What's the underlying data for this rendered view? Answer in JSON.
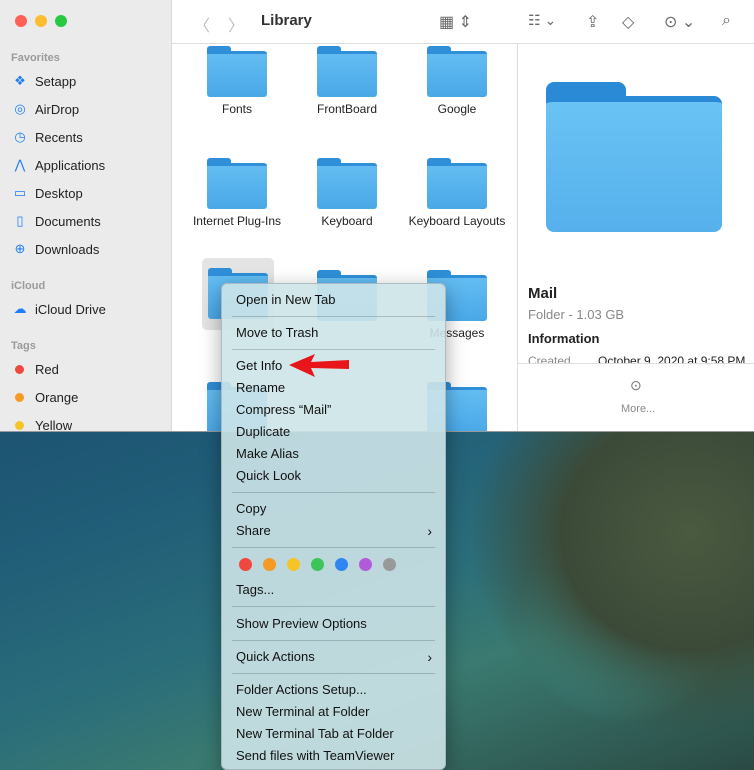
{
  "window": {
    "title": "Library"
  },
  "sidebar": {
    "favorites_label": "Favorites",
    "favorites": [
      {
        "label": "Setapp",
        "icon": "setapp-icon"
      },
      {
        "label": "AirDrop",
        "icon": "airdrop-icon"
      },
      {
        "label": "Recents",
        "icon": "clock-icon"
      },
      {
        "label": "Applications",
        "icon": "applications-icon"
      },
      {
        "label": "Desktop",
        "icon": "desktop-icon"
      },
      {
        "label": "Documents",
        "icon": "document-icon"
      },
      {
        "label": "Downloads",
        "icon": "download-icon"
      }
    ],
    "icloud_label": "iCloud",
    "icloud": [
      {
        "label": "iCloud Drive",
        "icon": "cloud-icon"
      }
    ],
    "tags_label": "Tags",
    "tags": [
      {
        "label": "Red",
        "color": "#f0473f"
      },
      {
        "label": "Orange",
        "color": "#f59a23"
      },
      {
        "label": "Yellow",
        "color": "#f5c426"
      }
    ]
  },
  "folders": [
    "Fonts",
    "FrontBoard",
    "Google",
    "Internet Plug-Ins",
    "Keyboard",
    "Keyboard Layouts",
    "Mail",
    "",
    "Messages"
  ],
  "preview": {
    "name": "Mail",
    "kind": "Folder - 1.03 GB",
    "section": "Information",
    "created_label": "Created",
    "created_value": "October 9, 2020 at 9:58 PM",
    "more": "More..."
  },
  "menu": {
    "items": [
      "Open in New Tab",
      "Move to Trash",
      "Get Info",
      "Rename",
      "Compress “Mail”",
      "Duplicate",
      "Make Alias",
      "Quick Look",
      "Copy",
      "Share",
      "Tags...",
      "Show Preview Options",
      "Quick Actions",
      "Folder Actions Setup...",
      "New Terminal at Folder",
      "New Terminal Tab at Folder",
      "Send files with TeamViewer"
    ],
    "tag_colors": [
      "#f0473f",
      "#f59a23",
      "#f5c426",
      "#3ec55a",
      "#2f86f0",
      "#b25bd9",
      "#999999"
    ]
  },
  "accent": "#1e7ef7",
  "annotation_color": "#e8161b"
}
